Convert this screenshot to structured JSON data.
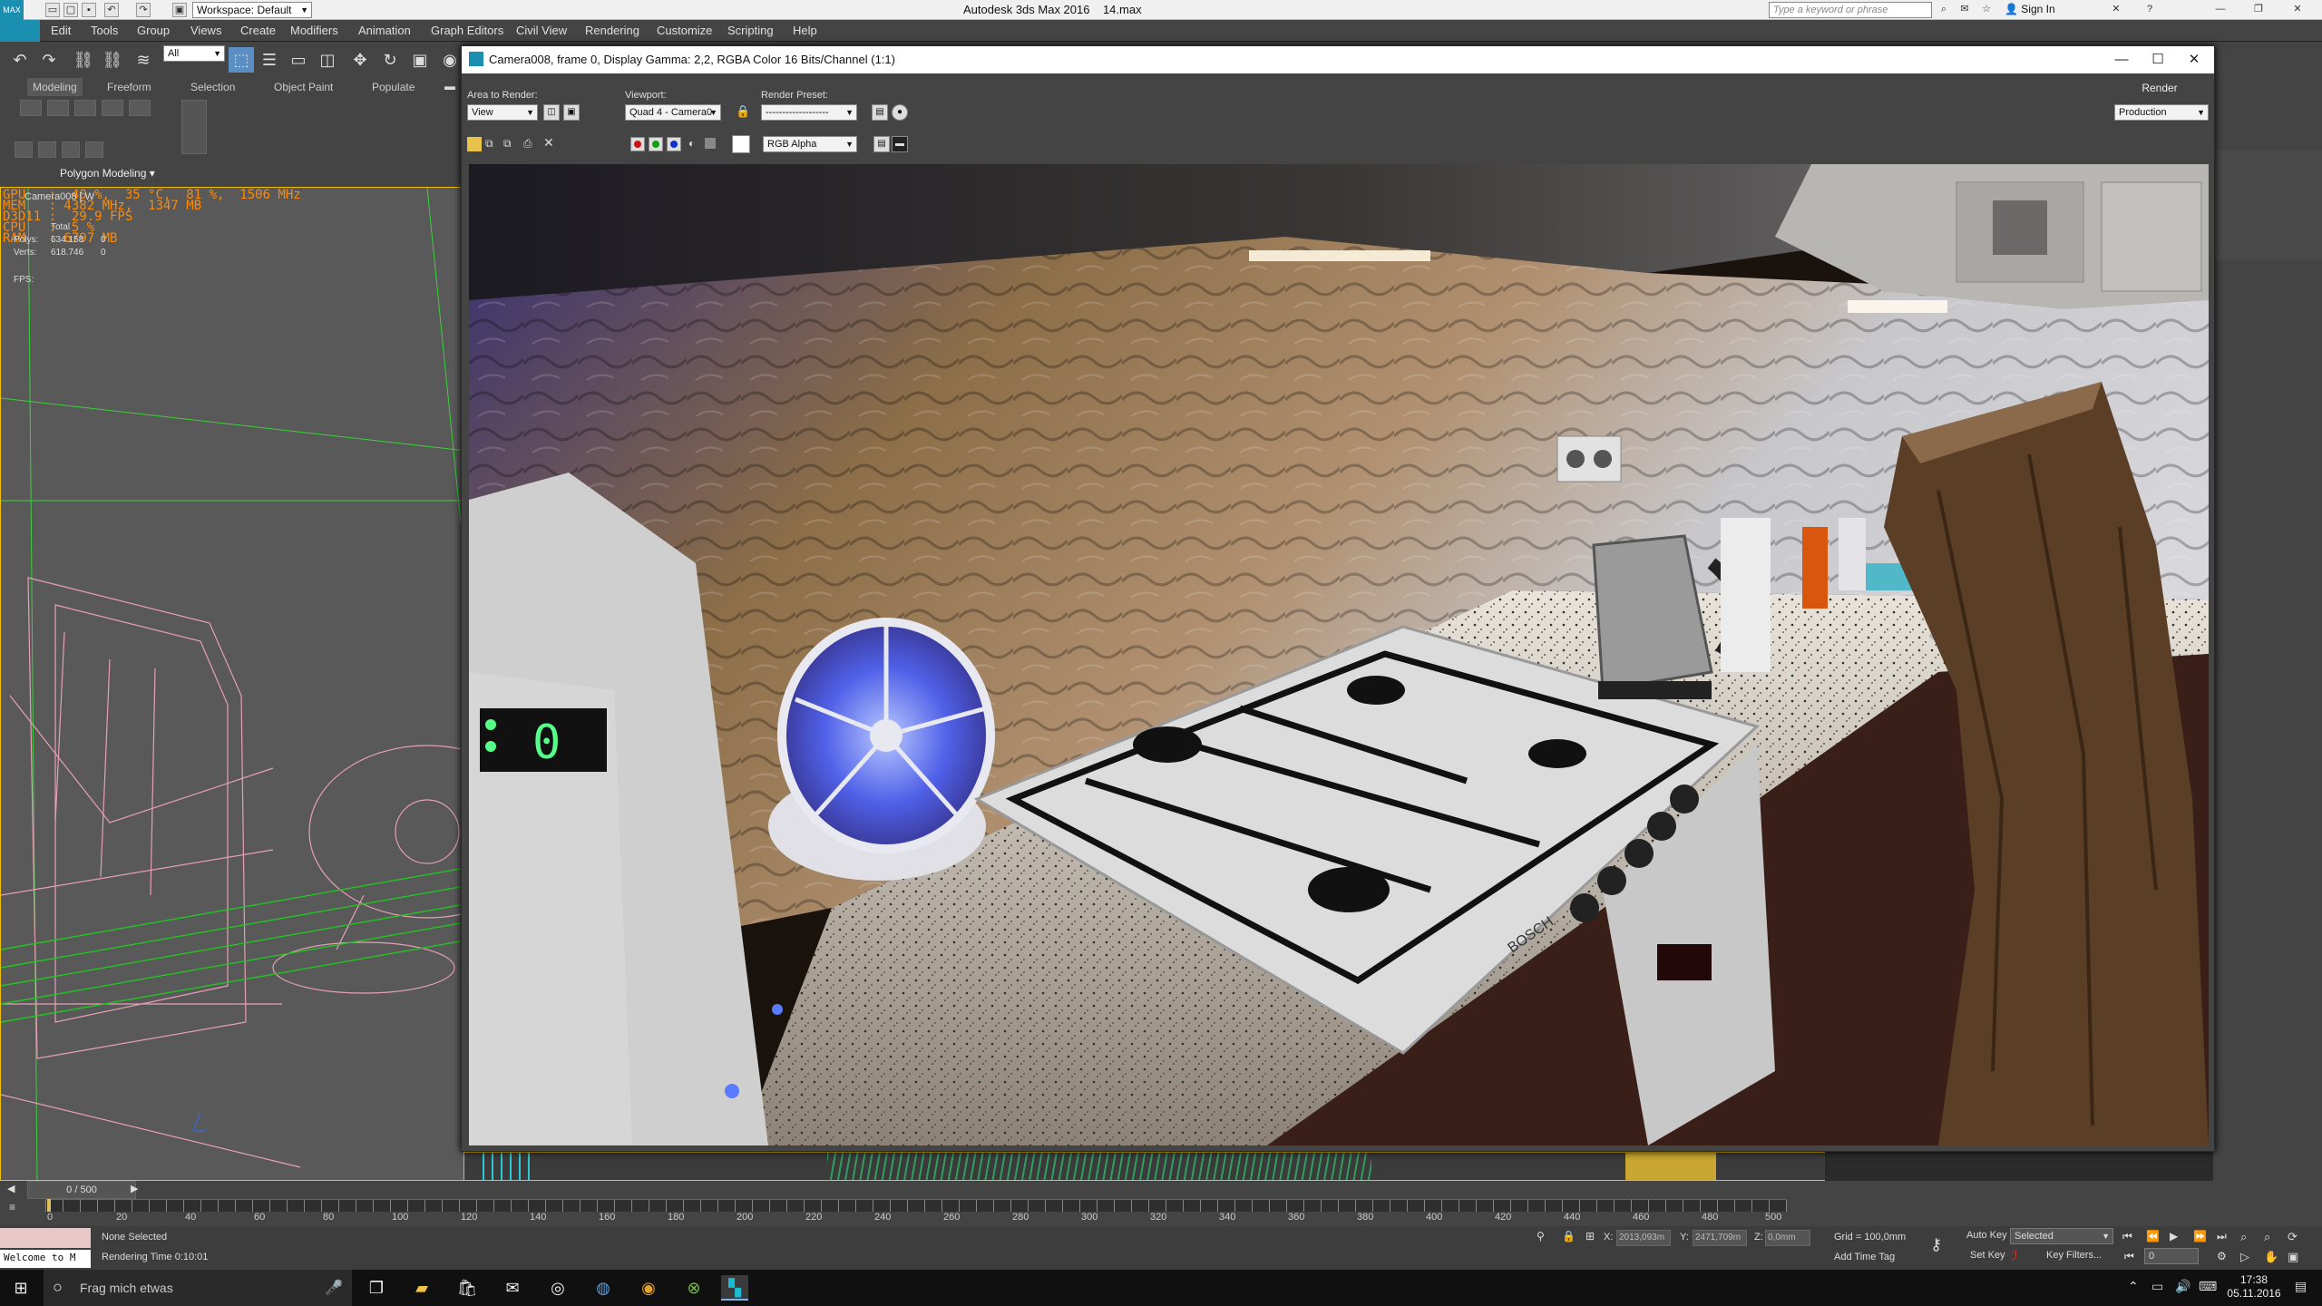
{
  "app": {
    "title": "Autodesk 3ds Max 2016",
    "file": "14.max",
    "workspace": "Workspace: Default",
    "search_placeholder": "Type a keyword or phrase",
    "sign_in": "Sign In"
  },
  "menu": [
    "Edit",
    "Tools",
    "Group",
    "Views",
    "Create",
    "Modifiers",
    "Animation",
    "Graph Editors",
    "Civil View",
    "Rendering",
    "Customize",
    "Scripting",
    "Help"
  ],
  "toolbar": {
    "selection_filter": "All"
  },
  "ribbon": {
    "tabs": [
      "Modeling",
      "Freeform",
      "Selection",
      "Object Paint",
      "Populate"
    ],
    "panel_label": "Polygon Modeling"
  },
  "viewport": {
    "label": "Camera008 [ W",
    "hud": {
      "gpu": "GPU   :  40 %,  35 °C,  81 %,  1506 MHz",
      "mem": "MEM   : 4382 MHz,  1347 MB",
      "d3d": "D3D11 :  29.9 FPS",
      "cpu": "CPU   :  5 %",
      "ram": "RAM   : 6797 MB",
      "total_label": "Total",
      "polys_label": "Polys:",
      "polys_value": "634.158",
      "polys_zero": "0",
      "verts_label": "Verts:",
      "verts_value": "618.746",
      "verts_zero": "0",
      "fps_label": "FPS:"
    }
  },
  "render_frame": {
    "title": "Camera008, frame 0, Display Gamma: 2,2, RGBA Color 16 Bits/Channel (1:1)",
    "area_to_render_label": "Area to Render:",
    "area_to_render_value": "View",
    "viewport_label": "Viewport:",
    "viewport_value": "Quad 4 - Camera0",
    "render_preset_label": "Render Preset:",
    "render_preset_value": "-------------------",
    "render_button": "Render",
    "production_value": "Production",
    "channel_value": "RGB Alpha"
  },
  "render_image": {
    "stove_brand": "BOSCH",
    "timer_digit": "0"
  },
  "timeline": {
    "frame_counter": "0 / 500",
    "ticks": [
      "0",
      "20",
      "40",
      "60",
      "80",
      "100",
      "120",
      "140",
      "160",
      "180",
      "200",
      "220",
      "240",
      "260",
      "280",
      "300",
      "320",
      "340",
      "360",
      "380",
      "400",
      "420",
      "440",
      "460",
      "480",
      "500"
    ]
  },
  "status": {
    "welcome": "Welcome to M",
    "selection": "None Selected",
    "rendering_time": "Rendering Time  0:10:01",
    "x_label": "X:",
    "x_value": "2013,093m",
    "y_label": "Y:",
    "y_value": "2471,709m",
    "z_label": "Z:",
    "z_value": "0,0mm",
    "grid": "Grid = 100,0mm",
    "add_time_tag": "Add Time Tag",
    "auto_key": "Auto Key",
    "set_key": "Set Key",
    "selected": "Selected",
    "key_filters": "Key Filters...",
    "frame_value": "0"
  },
  "taskbar": {
    "search": "Frag mich etwas",
    "time": "17:38",
    "date": "05.11.2016"
  }
}
